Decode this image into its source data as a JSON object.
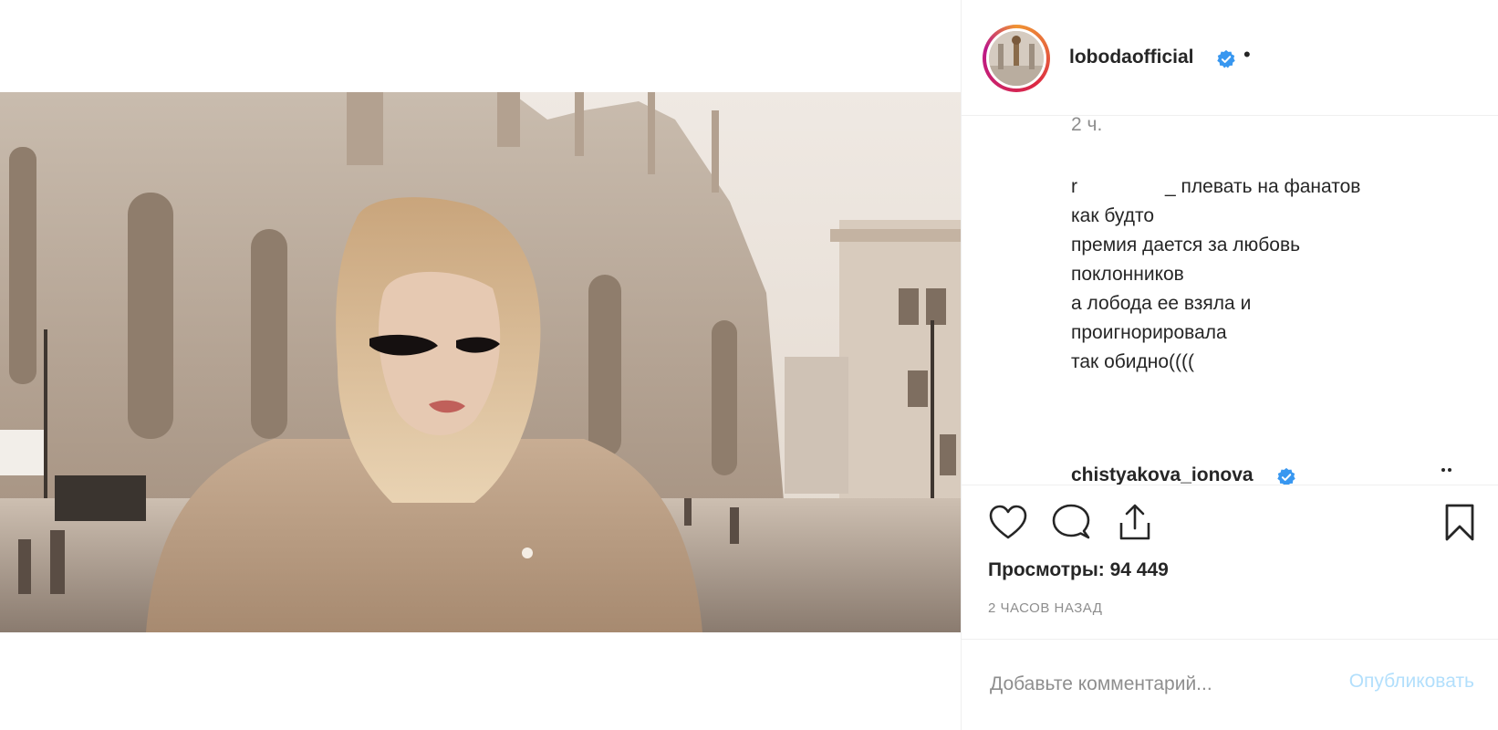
{
  "post": {
    "username": "lobodaofficial",
    "verified_icon": "verified-badge-icon",
    "separator": "•",
    "views_label": "Просмотры:",
    "views_count": "94 449",
    "timestamp": "2 ЧАСОВ НАЗАД"
  },
  "comments": {
    "time_ago": "2 ч.",
    "first": {
      "user_prefix": "r",
      "user_suffix": "_",
      "lines": [
        "плевать на фанатов",
        "как будто",
        "премия дается за любовь",
        "поклонников",
        "а лобода ее взяла и",
        "проигнорировала",
        "так обидно(((("
      ]
    },
    "second": {
      "username": "chistyakova_ionova"
    }
  },
  "actions": {
    "like_icon": "heart-icon",
    "comment_icon": "comment-icon",
    "share_icon": "share-icon",
    "save_icon": "bookmark-icon"
  },
  "add_comment": {
    "placeholder": "Добавьте комментарий...",
    "publish_label": "Опубликовать"
  },
  "colors": {
    "accent_verified": "#3897f0",
    "publish_disabled": "#b2dffc",
    "muted_text": "#8e8e8e"
  }
}
